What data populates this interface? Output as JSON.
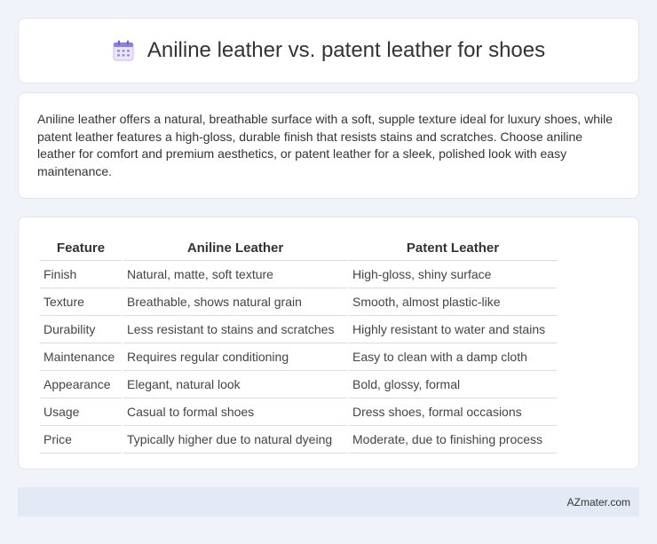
{
  "header": {
    "title": "Aniline leather vs. patent leather for shoes",
    "icon": "calendar-icon"
  },
  "summary": {
    "text": "Aniline leather offers a natural, breathable surface with a soft, supple texture ideal for luxury shoes, while patent leather features a high-gloss, durable finish that resists stains and scratches. Choose aniline leather for comfort and premium aesthetics, or patent leather for a sleek, polished look with easy maintenance."
  },
  "table": {
    "headers": [
      "Feature",
      "Aniline Leather",
      "Patent Leather"
    ],
    "rows": [
      [
        "Finish",
        "Natural, matte, soft texture",
        "High-gloss, shiny surface"
      ],
      [
        "Texture",
        "Breathable, shows natural grain",
        "Smooth, almost plastic-like"
      ],
      [
        "Durability",
        "Less resistant to stains and scratches",
        "Highly resistant to water and stains"
      ],
      [
        "Maintenance",
        "Requires regular conditioning",
        "Easy to clean with a damp cloth"
      ],
      [
        "Appearance",
        "Elegant, natural look",
        "Bold, glossy, formal"
      ],
      [
        "Usage",
        "Casual to formal shoes",
        "Dress shoes, formal occasions"
      ],
      [
        "Price",
        "Typically higher due to natural dyeing",
        "Moderate, due to finishing process"
      ]
    ]
  },
  "footer": {
    "brand": "AZmater.com"
  },
  "colors": {
    "background": "#f0f3f9",
    "card": "#ffffff",
    "footer": "#e4eaf5"
  }
}
